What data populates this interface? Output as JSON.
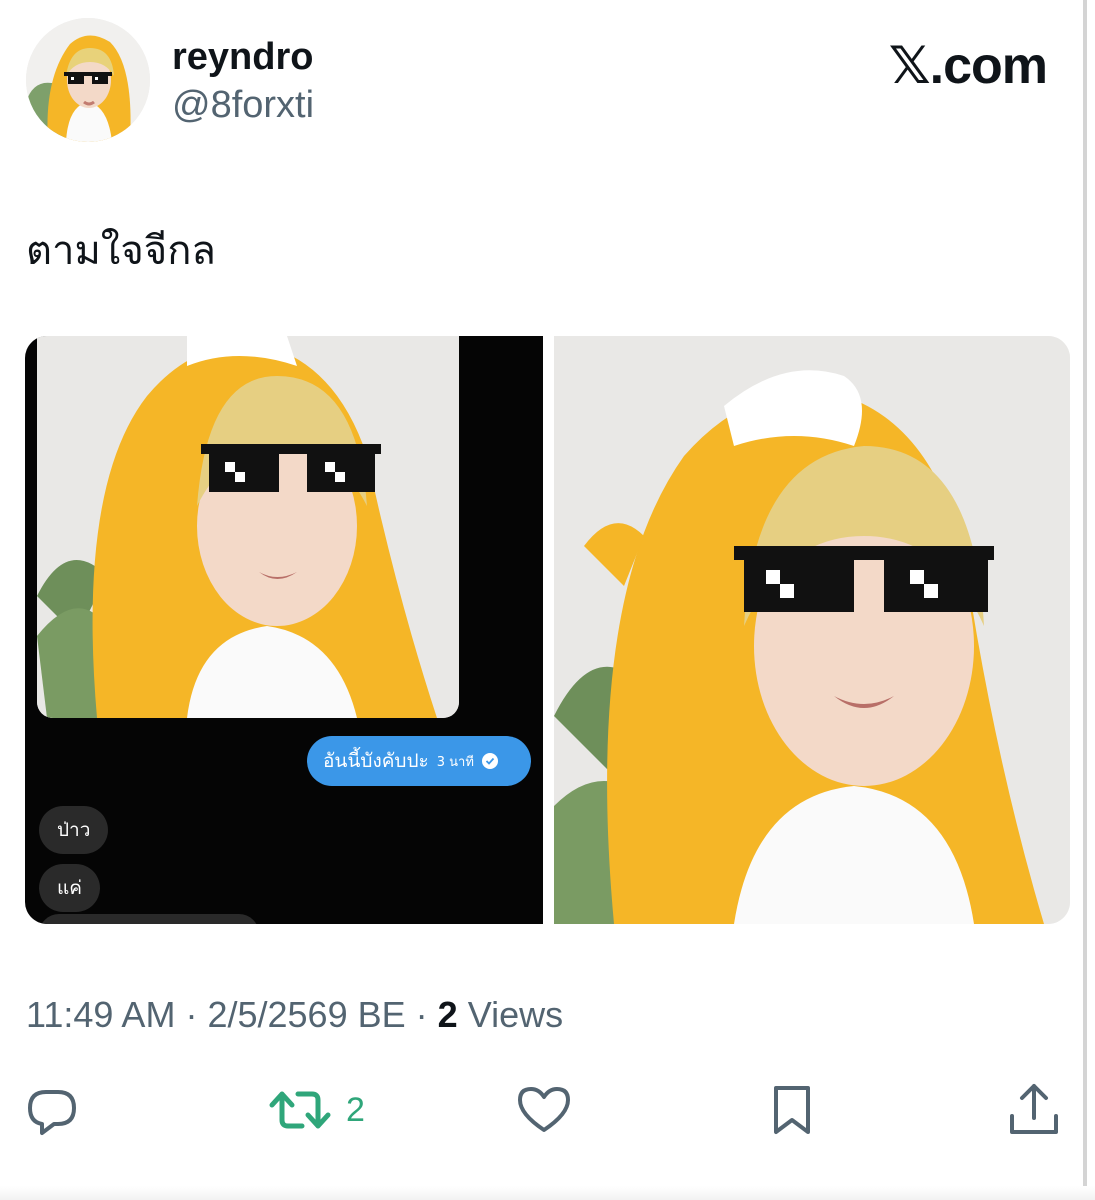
{
  "header": {
    "display_name": "reyndro",
    "handle": "@8forxti",
    "brand": "𝕏.com"
  },
  "tweet": {
    "text": "ตามใจจีกล"
  },
  "media": {
    "screenshot_chat": {
      "outgoing_message": "อันนี้บังคับปะ",
      "outgoing_time": "3 นาที",
      "incoming_messages": [
        "ป่าว",
        "แค่"
      ]
    }
  },
  "meta": {
    "time": "11:49 AM",
    "separator": "·",
    "date": "2/5/2569 BE",
    "views_count": "2",
    "views_label": "Views"
  },
  "actions": {
    "reply": {
      "icon": "reply-icon"
    },
    "retweet": {
      "icon": "retweet-icon",
      "count": "2",
      "color": "#2fa67a"
    },
    "like": {
      "icon": "heart-icon"
    },
    "bookmark": {
      "icon": "bookmark-icon"
    },
    "share": {
      "icon": "share-icon"
    }
  },
  "colors": {
    "text_primary": "#0f1419",
    "text_secondary": "#536471",
    "chat_bubble": "#3b97e8",
    "hoodie_yellow": "#f5b627"
  }
}
